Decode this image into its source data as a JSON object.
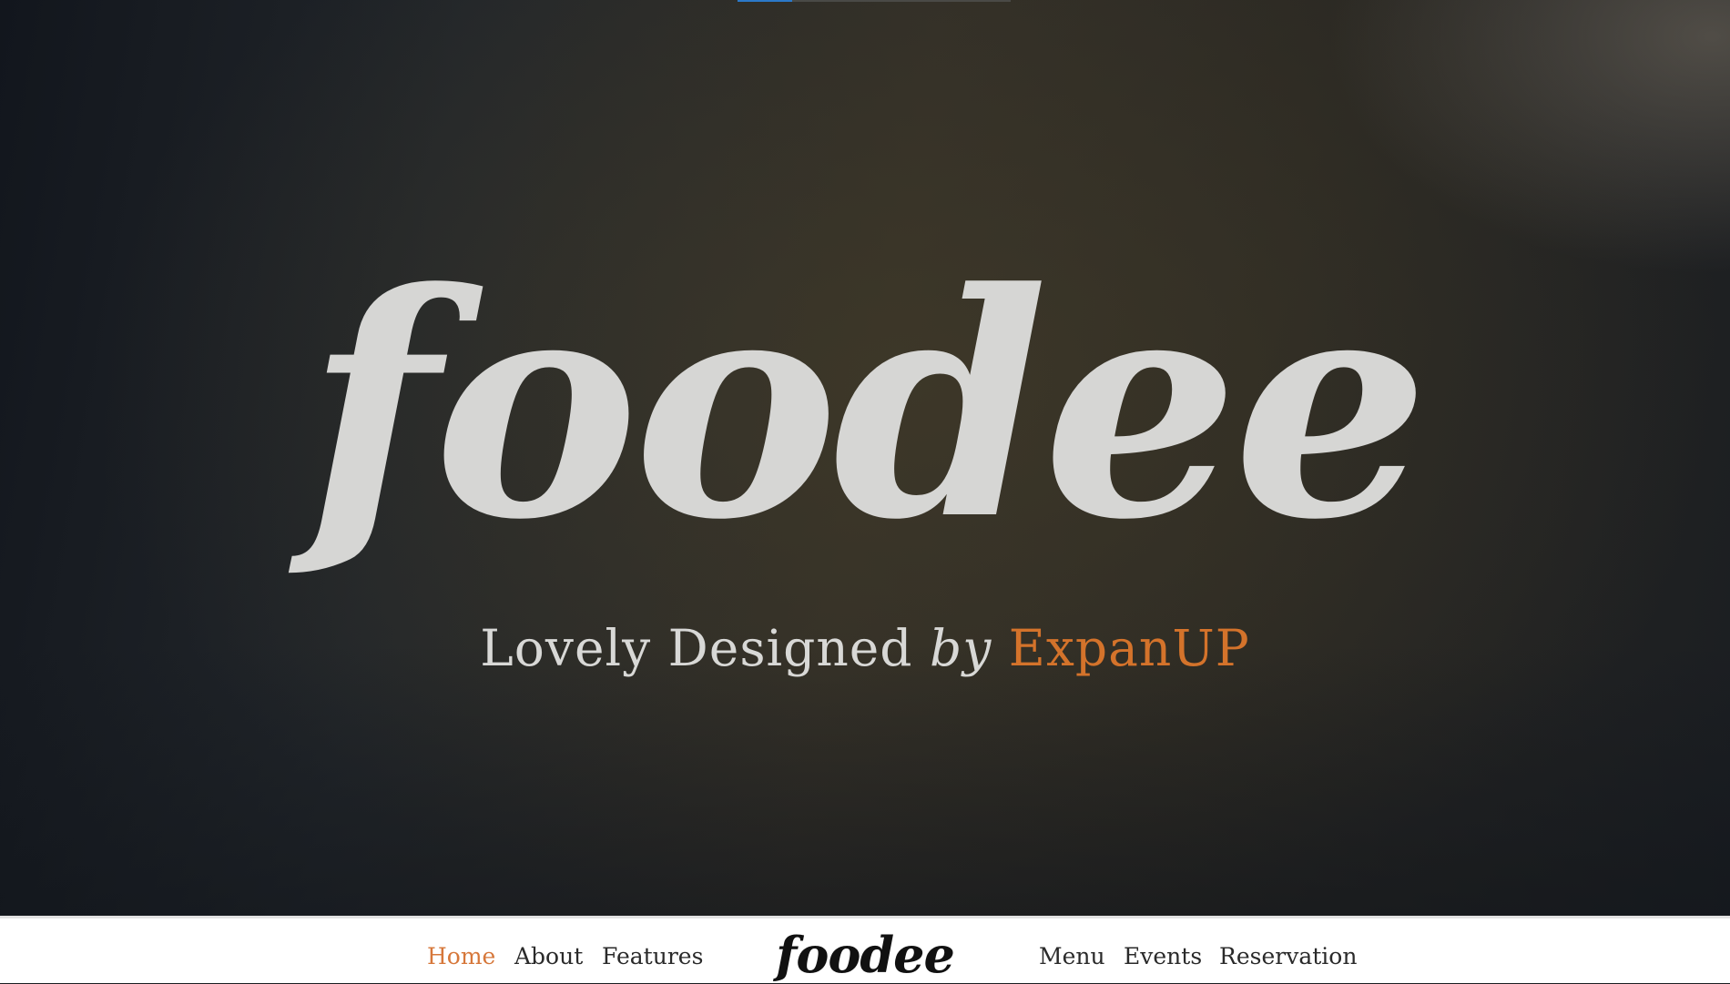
{
  "hero": {
    "title": "foodee",
    "subtitle_prefix": "Lovely Designed ",
    "subtitle_by": "by",
    "subtitle_brand": "ExpanUP",
    "brand_color": "#d4732b"
  },
  "nav": {
    "left_items": [
      {
        "label": "Home",
        "active": true
      },
      {
        "label": "About",
        "active": false
      },
      {
        "label": "Features",
        "active": false
      }
    ],
    "logo": "foodee",
    "right_items": [
      {
        "label": "Menu",
        "active": false
      },
      {
        "label": "Events",
        "active": false
      },
      {
        "label": "Reservation",
        "active": false
      }
    ],
    "active_color": "#d6773a",
    "text_color": "#2a2a2a"
  },
  "slider_indicator": {
    "accent_color": "#2b79c9"
  }
}
